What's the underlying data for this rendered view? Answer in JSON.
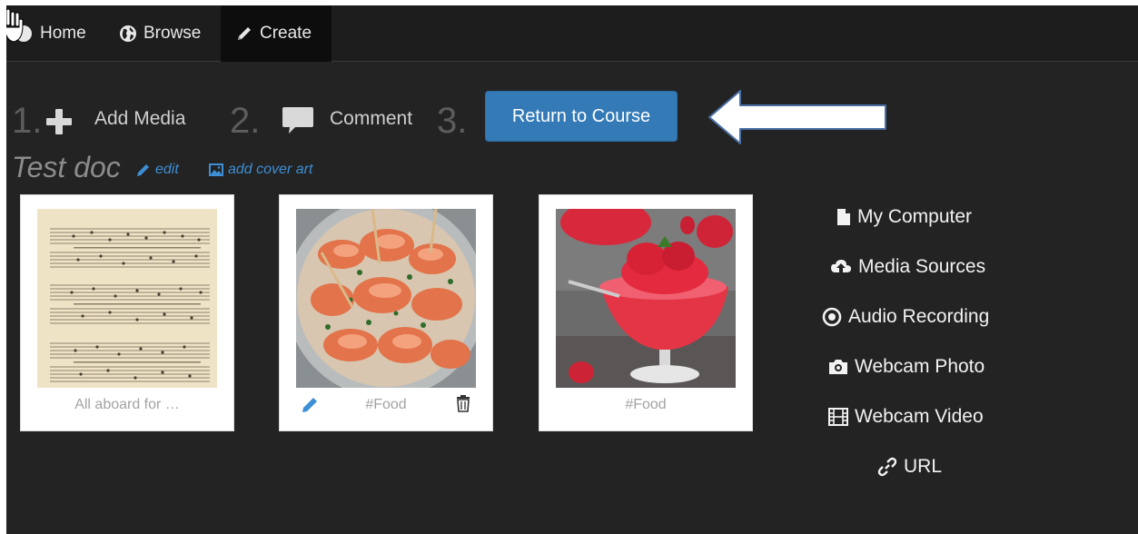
{
  "nav": {
    "home": "Home",
    "browse": "Browse",
    "create": "Create"
  },
  "steps": {
    "one_num": "1.",
    "one_label": "Add Media",
    "two_num": "2.",
    "two_label": "Comment",
    "three_num": "3.",
    "return_label": "Return to Course"
  },
  "document": {
    "title": "Test doc",
    "edit_label": "edit",
    "cover_label": "add cover art"
  },
  "cards": [
    {
      "caption": "All aboard for …",
      "image": "sheet-music"
    },
    {
      "caption": "#Food",
      "image": "shrimp-dish"
    },
    {
      "caption": "#Food",
      "image": "strawberry-sorbet"
    }
  ],
  "sources": [
    {
      "label": "My Computer",
      "icon": "file-icon"
    },
    {
      "label": "Media Sources",
      "icon": "cloud-upload-icon"
    },
    {
      "label": "Audio Recording",
      "icon": "record-icon"
    },
    {
      "label": "Webcam Photo",
      "icon": "camera-icon"
    },
    {
      "label": "Webcam Video",
      "icon": "film-icon"
    },
    {
      "label": "URL",
      "icon": "link-icon"
    }
  ],
  "colors": {
    "background": "#232323",
    "navbar": "#1d1d1d",
    "accent": "#337ab7",
    "link": "#3d8fd6"
  }
}
